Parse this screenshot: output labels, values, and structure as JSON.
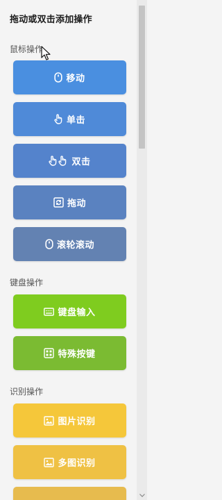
{
  "panel": {
    "title": "拖动或双击添加操作"
  },
  "sections": {
    "mouse": {
      "label": "鼠标操作",
      "buttons": [
        {
          "label": "移动",
          "icon": "mouse-icon",
          "color": "#4a8fe0"
        },
        {
          "label": "单击",
          "icon": "pointer-hand-icon",
          "color": "#4f8ad8"
        },
        {
          "label": "双击",
          "icon": "double-click-icon",
          "color": "#5483cc"
        },
        {
          "label": "拖动",
          "icon": "drag-icon",
          "color": "#5a82c0"
        },
        {
          "label": "滚轮滚动",
          "icon": "scroll-wheel-icon",
          "color": "#6382b2"
        }
      ]
    },
    "keyboard": {
      "label": "键盘操作",
      "buttons": [
        {
          "label": "键盘输入",
          "icon": "keyboard-icon",
          "color": "#7fcc1f"
        },
        {
          "label": "特殊按键",
          "icon": "special-keys-icon",
          "color": "#7bbb32"
        }
      ]
    },
    "recognition": {
      "label": "识别操作",
      "buttons": [
        {
          "label": "图片识别",
          "icon": "image-recognition-icon",
          "color": "#f5c73a"
        },
        {
          "label": "多图识别",
          "icon": "multi-image-recognition-icon",
          "color": "#efc144"
        },
        {
          "label": "",
          "icon": "",
          "color": "#e7bb4e"
        }
      ]
    }
  }
}
